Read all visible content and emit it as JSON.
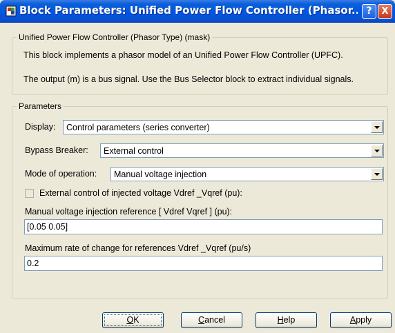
{
  "window": {
    "title": "Block Parameters: Unified Power Flow Controller (Phasor...",
    "help_glyph": "?",
    "close_glyph": "X"
  },
  "description": {
    "group_label": "Unified Power Flow Controller (Phasor Type) (mask)",
    "line1": "This block implements a phasor model of an Unified Power Flow Controller (UPFC).",
    "line2": "The output (m) is a bus signal. Use the Bus Selector block to extract individual signals."
  },
  "parameters": {
    "group_label": "Parameters",
    "display": {
      "label": "Display:",
      "value": "Control parameters (series converter)"
    },
    "bypass_breaker": {
      "label": "Bypass Breaker:",
      "value": "External control"
    },
    "mode_of_operation": {
      "label": "Mode of operation:",
      "value": "Manual voltage injection"
    },
    "external_control": {
      "label": "External control of injected voltage Vdref _Vqref (pu):",
      "checked": false
    },
    "manual_ref": {
      "label": "Manual voltage injection reference [ Vdref  Vqref ] (pu):",
      "value": "[0.05 0.05]"
    },
    "max_rate": {
      "label": "Maximum rate of change for references Vdref _Vqref (pu/s)",
      "value": "0.2"
    }
  },
  "buttons": {
    "ok": {
      "underline": "O",
      "rest": "K"
    },
    "cancel": {
      "underline": "C",
      "rest": "ancel"
    },
    "help": {
      "underline": "H",
      "rest": "elp"
    },
    "apply": {
      "underline": "A",
      "rest": "pply"
    }
  },
  "colors": {
    "title_bar": "#0055e5",
    "dialog_bg": "#ece9d8"
  }
}
